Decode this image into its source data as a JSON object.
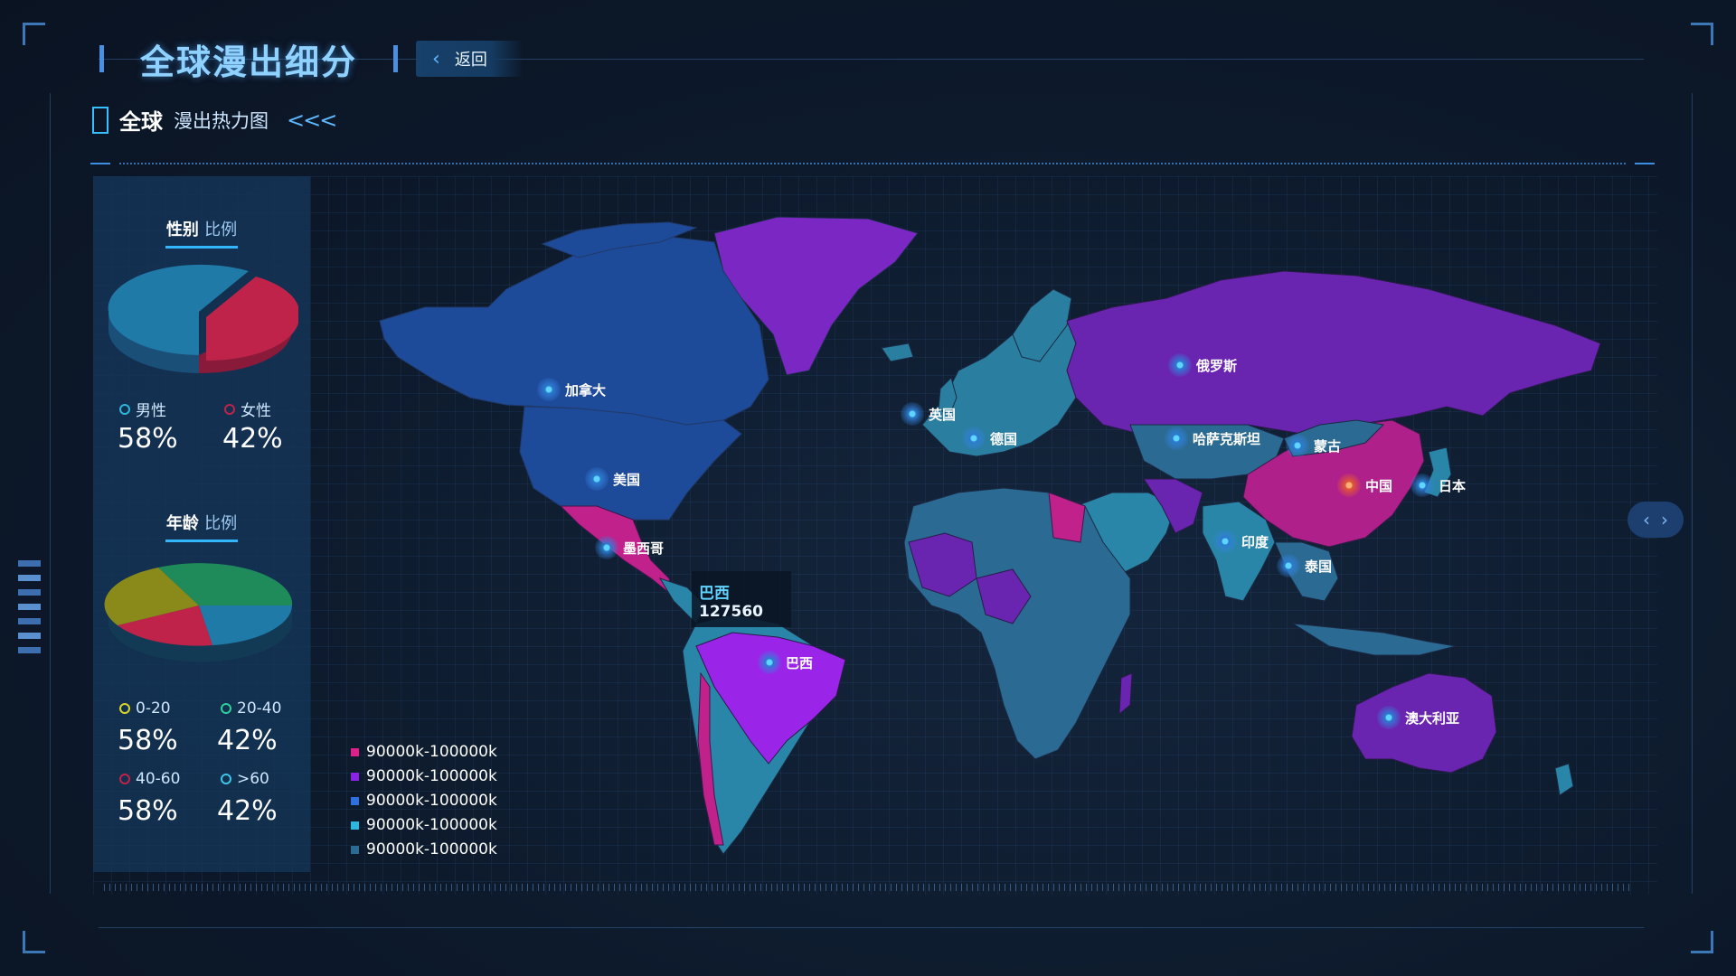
{
  "header": {
    "title": "全球漫出细分",
    "back_label": "返回"
  },
  "section": {
    "title": "全球",
    "subtitle": "漫出热力图",
    "arrows": "<<<"
  },
  "gender_panel": {
    "title": "性别",
    "title_accent": "比例",
    "items": [
      {
        "label": "男性",
        "value": "58%",
        "color": "#2fb6d8"
      },
      {
        "label": "女性",
        "value": "42%",
        "color": "#c0234a"
      }
    ]
  },
  "age_panel": {
    "title": "年龄",
    "title_accent": "比例",
    "items": [
      {
        "label": "0-20",
        "value": "58%",
        "color": "#d8d62a"
      },
      {
        "label": "20-40",
        "value": "42%",
        "color": "#2fd09a"
      },
      {
        "label": "40-60",
        "value": "58%",
        "color": "#c0234a"
      },
      {
        "label": ">60",
        "value": "42%",
        "color": "#3ec6e8"
      }
    ]
  },
  "map_legend": [
    {
      "label": "90000k-100000k",
      "color": "#e0208a"
    },
    {
      "label": "90000k-100000k",
      "color": "#8a22e8"
    },
    {
      "label": "90000k-100000k",
      "color": "#2f6fe0"
    },
    {
      "label": "90000k-100000k",
      "color": "#2cb6e0"
    },
    {
      "label": "90000k-100000k",
      "color": "#2b6a93"
    }
  ],
  "map_pins": {
    "canada": "加拿大",
    "usa": "美国",
    "mexico": "墨西哥",
    "brazil": "巴西",
    "uk": "英国",
    "germany": "德国",
    "russia": "俄罗斯",
    "kazakhstan": "哈萨克斯坦",
    "mongolia": "蒙古",
    "china": "中国",
    "japan": "日本",
    "india": "印度",
    "thailand": "泰国",
    "australia": "澳大利亚"
  },
  "tooltip": {
    "name": "巴西",
    "value": "127560"
  },
  "nav": {
    "prev": "‹",
    "next": "›"
  }
}
